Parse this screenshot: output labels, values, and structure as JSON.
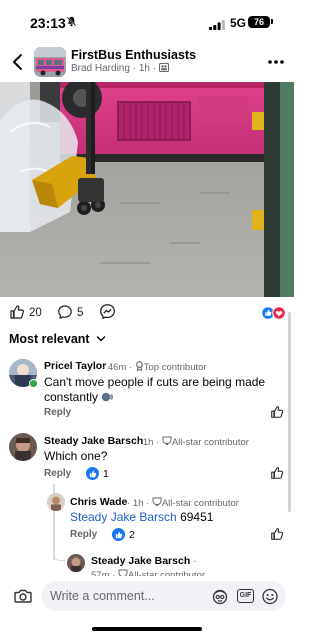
{
  "status_bar": {
    "time": "23:13",
    "network": "5G",
    "battery": "76"
  },
  "header": {
    "group_name": "FirstBus Enthusiasts",
    "author": "Brad Harding",
    "time_ago": "1h",
    "privacy_icon": "group-members-icon",
    "more_icon": "more-horizontal-icon",
    "back_icon": "chevron-left-icon"
  },
  "post": {
    "image_description_icon": "photo-pink-bus-pallet-truck"
  },
  "reactions": {
    "likes": "20",
    "comments": "5",
    "emojis": [
      "like",
      "love"
    ]
  },
  "sort": {
    "label": "Most relevant"
  },
  "comments": [
    {
      "author": "Pricel Taylor",
      "time_ago": "46m",
      "badge": "Top contributor",
      "text_line1": "Can't move people if cuts are being made",
      "text_line2": "constantly",
      "reply_label": "Reply"
    },
    {
      "author": "Steady Jake Barsch",
      "time_ago": "1h",
      "badge": "All-star contributor",
      "text": "Which one?",
      "reply_label": "Reply",
      "like_count": "1"
    },
    {
      "author": "Chris Wade",
      "time_ago": "1h",
      "badge": "All-star contributor",
      "mention": "Steady Jake Barsch",
      "text": "69451",
      "reply_label": "Reply",
      "like_count": "2"
    },
    {
      "author": "Steady Jake Barsch",
      "separator": "·",
      "time_ago": "57m",
      "badge": "All-star contributor"
    }
  ],
  "composer": {
    "placeholder": "Write a comment...",
    "gif_label": "GIF"
  },
  "colors": {
    "accent_blue": "#1877f2",
    "mention_blue": "#1f62c7",
    "love_red": "#f02849",
    "muted_text": "#65676b"
  }
}
